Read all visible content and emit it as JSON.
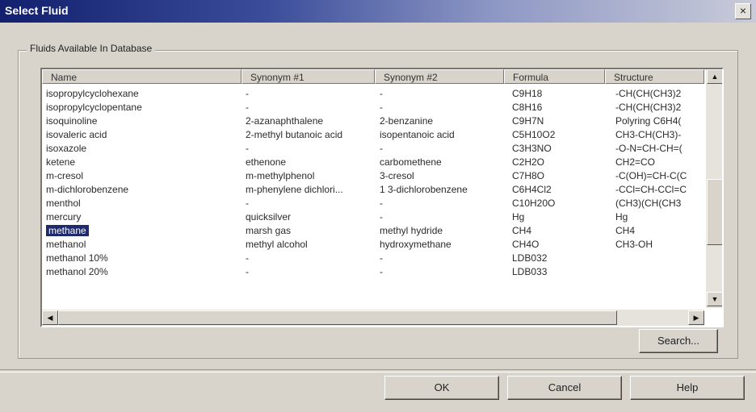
{
  "window": {
    "title": "Select Fluid",
    "close_glyph": "×"
  },
  "group": {
    "label": "Fluids Available In Database"
  },
  "table": {
    "columns": [
      "Name",
      "Synonym #1",
      "Synonym #2",
      "Formula",
      "Structure"
    ],
    "rows": [
      [
        "isopropylcyclohexane",
        "-",
        "-",
        "C9H18",
        "-CH(CH(CH3)2"
      ],
      [
        "isopropylcyclopentane",
        "-",
        "-",
        "C8H16",
        "-CH(CH(CH3)2"
      ],
      [
        "isoquinoline",
        "2-azanaphthalene",
        "2-benzanine",
        "C9H7N",
        "Polyring C6H4("
      ],
      [
        "isovaleric acid",
        "2-methyl butanoic acid",
        "isopentanoic acid",
        "C5H10O2",
        "CH3-CH(CH3)-"
      ],
      [
        "isoxazole",
        "-",
        "-",
        "C3H3NO",
        "-O-N=CH-CH=("
      ],
      [
        "ketene",
        "ethenone",
        "carbomethene",
        "C2H2O",
        "CH2=CO"
      ],
      [
        "m-cresol",
        "m-methylphenol",
        "3-cresol",
        "C7H8O",
        "-C(OH)=CH-C(C"
      ],
      [
        "m-dichlorobenzene",
        "m-phenylene dichlori...",
        "1 3-dichlorobenzene",
        "C6H4Cl2",
        "-CCl=CH-CCl=C"
      ],
      [
        "menthol",
        "-",
        "-",
        "C10H20O",
        "(CH3)(CH(CH3"
      ],
      [
        "mercury",
        "quicksilver",
        "-",
        "Hg",
        "Hg"
      ],
      [
        "methane",
        "marsh gas",
        "methyl hydride",
        "CH4",
        "CH4"
      ],
      [
        "methanol",
        "methyl alcohol",
        "hydroxymethane",
        "CH4O",
        "CH3-OH"
      ],
      [
        "methanol 10%",
        "-",
        "-",
        "LDB032",
        ""
      ],
      [
        "methanol 20%",
        "-",
        "-",
        "LDB033",
        ""
      ]
    ],
    "selected_row": 10
  },
  "scrollbar": {
    "up": "▲",
    "down": "▼",
    "left": "◀",
    "right": "▶"
  },
  "buttons": {
    "search": "Search...",
    "ok": "OK",
    "cancel": "Cancel",
    "help": "Help"
  }
}
